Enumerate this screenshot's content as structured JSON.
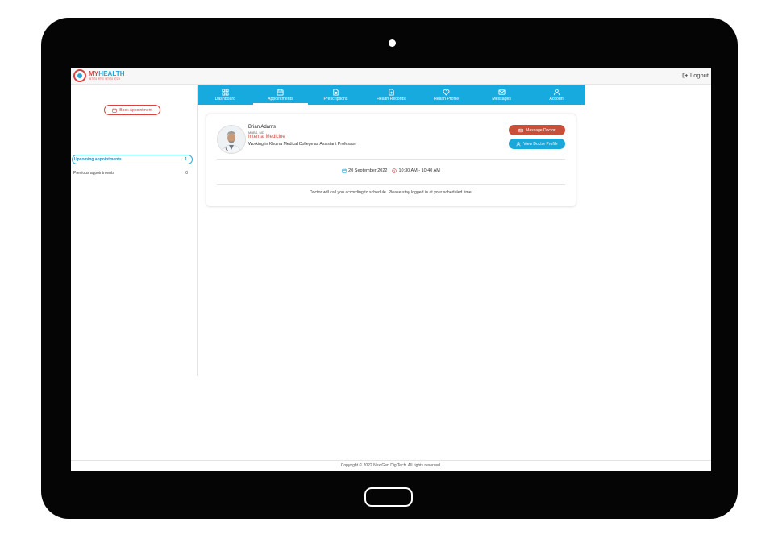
{
  "app": {
    "logo_my": "MY",
    "logo_health": "HEALTH",
    "logo_tagline": "আমার স্বাস্থ্য আমার হাতে",
    "logout_label": "Logout"
  },
  "sidebar": {
    "book_label": "Book Appointment",
    "items": [
      {
        "label": "Upcoming appointments",
        "count": "1"
      },
      {
        "label": "Previous appointments",
        "count": "0"
      }
    ]
  },
  "nav": {
    "tabs": [
      {
        "label": "Dashboard",
        "icon": "dashboard-icon"
      },
      {
        "label": "Appointments",
        "icon": "calendar-icon"
      },
      {
        "label": "Prescriptions",
        "icon": "document-icon"
      },
      {
        "label": "Health Records",
        "icon": "medical-file-icon"
      },
      {
        "label": "Health Profile",
        "icon": "heart-icon"
      },
      {
        "label": "Messages",
        "icon": "envelope-icon"
      },
      {
        "label": "Account",
        "icon": "user-icon"
      }
    ],
    "active": "Appointments"
  },
  "appointment": {
    "doctor_name": "Brian Adams",
    "degree": "MBBS, MD",
    "specialty": "Internal Medicine",
    "workplace": "Working in Khulna Medical College as Assistant Professor",
    "message_label": "Message Doctor",
    "profile_label": "View Doctor Profile",
    "date": "20 September 2022",
    "time": "10:30 AM - 10:40 AM",
    "note": "Doctor will call you according to schedule. Please stay logged in at your scheduled time."
  },
  "footer": {
    "copyright": "Copyright © 2022 NextGen DigiTech. All rights reserved."
  },
  "colors": {
    "brand_blue": "#16aadf",
    "brand_red": "#c8503b"
  }
}
